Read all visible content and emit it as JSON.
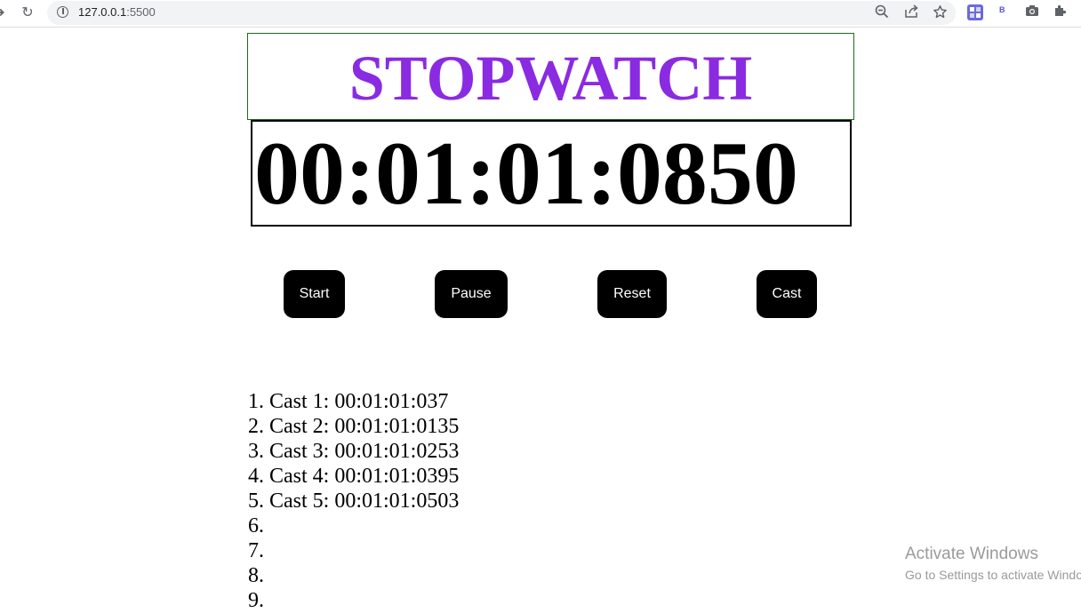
{
  "browser": {
    "url_host": "127.0.0.1",
    "url_port": ":5500"
  },
  "page": {
    "title": "STOPWATCH",
    "display": "00:01:01:0850",
    "buttons": {
      "start": "Start",
      "pause": "Pause",
      "reset": "Reset",
      "cast": "Cast"
    },
    "laps": [
      "1. Cast 1: 00:01:01:037",
      "2. Cast 2: 00:01:01:0135",
      "3. Cast 3: 00:01:01:0253",
      "4. Cast 4: 00:01:01:0395",
      "5. Cast 5: 00:01:01:0503",
      "6.",
      "7.",
      "8.",
      "9."
    ]
  },
  "watermark": {
    "line1": "Activate Windows",
    "line2": "Go to Settings to activate Windows."
  },
  "colors": {
    "title": "#8a2be2",
    "button_bg": "#000000",
    "button_text": "#ffffff",
    "title_border": "#1f6b1f"
  }
}
